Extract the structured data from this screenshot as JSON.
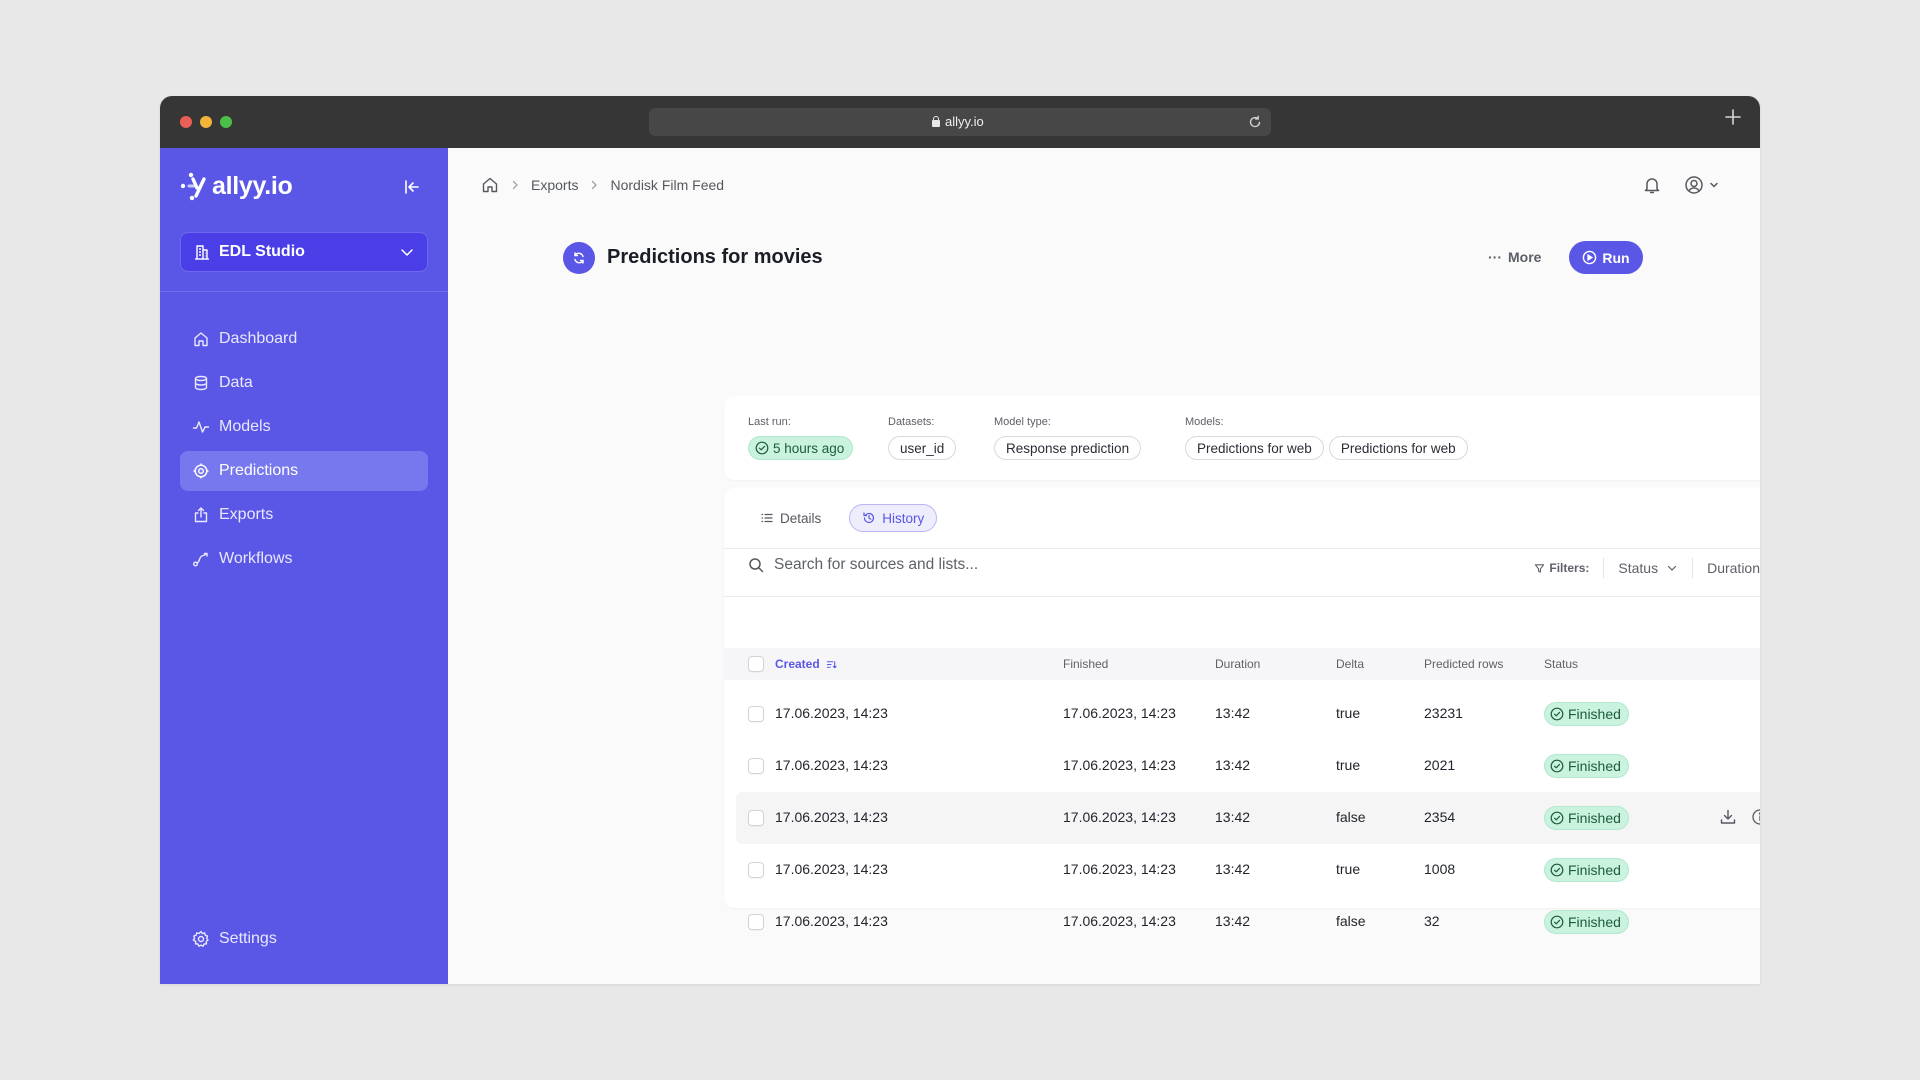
{
  "browser": {
    "url": "allyy.io"
  },
  "sidebar": {
    "brand": "allyy.io",
    "workspace": "EDL Studio",
    "items": [
      {
        "label": "Dashboard",
        "icon": "home-icon",
        "active": false
      },
      {
        "label": "Data",
        "icon": "database-icon",
        "active": false
      },
      {
        "label": "Models",
        "icon": "activity-icon",
        "active": false
      },
      {
        "label": "Predictions",
        "icon": "target-icon",
        "active": true
      },
      {
        "label": "Exports",
        "icon": "upload-icon",
        "active": false
      },
      {
        "label": "Workflows",
        "icon": "route-icon",
        "active": false
      }
    ],
    "settings_label": "Settings"
  },
  "header": {
    "breadcrumb": [
      "Exports",
      "Nordisk Film Feed"
    ]
  },
  "page": {
    "title": "Predictions for movies",
    "more_label": "More",
    "run_label": "Run"
  },
  "info": {
    "last_run_label": "Last run:",
    "last_run_value": "5 hours ago",
    "datasets_label": "Datasets:",
    "datasets": [
      "user_id"
    ],
    "model_type_label": "Model type:",
    "model_type": "Response prediction",
    "models_label": "Models:",
    "models": [
      "Predictions for web",
      "Predictions for web"
    ]
  },
  "tabs": [
    {
      "label": "Details",
      "active": false
    },
    {
      "label": "History",
      "active": true
    }
  ],
  "search": {
    "placeholder": "Search for sources and lists..."
  },
  "filters": {
    "label": "Filters:",
    "status": "Status",
    "duration": "Duration"
  },
  "table": {
    "columns": [
      "Created",
      "Finished",
      "Duration",
      "Delta",
      "Predicted rows",
      "Status"
    ],
    "rows": [
      {
        "created": "17.06.2023, 14:23",
        "finished": "17.06.2023, 14:23",
        "duration": "13:42",
        "delta": "true",
        "predicted_rows": "23231",
        "status": "Finished"
      },
      {
        "created": "17.06.2023, 14:23",
        "finished": "17.06.2023, 14:23",
        "duration": "13:42",
        "delta": "true",
        "predicted_rows": "2021",
        "status": "Finished"
      },
      {
        "created": "17.06.2023, 14:23",
        "finished": "17.06.2023, 14:23",
        "duration": "13:42",
        "delta": "false",
        "predicted_rows": "2354",
        "status": "Finished"
      },
      {
        "created": "17.06.2023, 14:23",
        "finished": "17.06.2023, 14:23",
        "duration": "13:42",
        "delta": "true",
        "predicted_rows": "1008",
        "status": "Finished"
      },
      {
        "created": "17.06.2023, 14:23",
        "finished": "17.06.2023, 14:23",
        "duration": "13:42",
        "delta": "false",
        "predicted_rows": "32",
        "status": "Finished"
      }
    ]
  },
  "colors": {
    "brand": "#5a57e6",
    "sidebar_active": "#7778ee",
    "success_bg": "#c9f2df",
    "success_text": "#1f5c3c"
  }
}
